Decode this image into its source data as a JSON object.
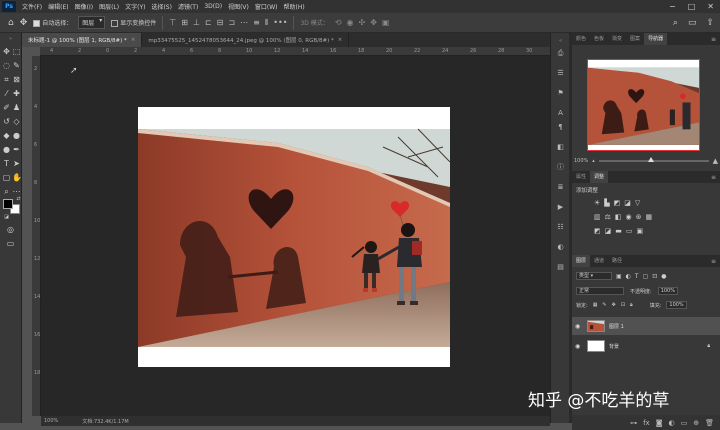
{
  "app": {
    "logo_text": "Ps"
  },
  "menu": {
    "items": [
      "文件(F)",
      "编辑(E)",
      "图像(I)",
      "图层(L)",
      "文字(Y)",
      "选择(S)",
      "滤镜(T)",
      "3D(D)",
      "视图(V)",
      "窗口(W)",
      "帮助(H)"
    ],
    "window_buttons": [
      "−",
      "□",
      "✕"
    ]
  },
  "options": {
    "auto_select_label": "自动选择：",
    "auto_select_value": "图层",
    "transform_controls_label": "显示变换控件",
    "mode_3d_label": "3D 模式："
  },
  "tabs": [
    {
      "label": "未标题-1 @ 100% (图层 1, RGB/8#) *",
      "active": true
    },
    {
      "label": "mp33475525_1452478053644_24.jpeg @ 100% (图层 0, RGB/8#) *",
      "active": false
    }
  ],
  "rulers": {
    "top": [
      "4",
      "2",
      "0",
      "2",
      "4",
      "6",
      "8",
      "10",
      "12",
      "14",
      "16",
      "18",
      "20",
      "22",
      "24",
      "26",
      "28",
      "30"
    ],
    "left": [
      "2",
      "4",
      "6",
      "8",
      "10",
      "12",
      "14",
      "16",
      "18"
    ]
  },
  "status": {
    "zoom": "100%",
    "doc_info": "文档:732.4K/1.17M"
  },
  "right_panels": {
    "top_tabs": [
      "颜色",
      "色板",
      "渐变",
      "图案",
      "导航器"
    ],
    "active_top_tab": "导航器",
    "nav_zoom": "100%",
    "adj_tabs": [
      "属性",
      "调整"
    ],
    "adj_title": "添加调整",
    "layers_tabs": [
      "图层",
      "通道",
      "路径"
    ],
    "kind_filter": "类型",
    "blend_mode": "正常",
    "opacity_label": "不透明度:",
    "opacity_value": "100%",
    "lock_label": "锁定:",
    "fill_label": "填充:",
    "fill_value": "100%",
    "layers": [
      {
        "name": "图层 1",
        "selected": true
      },
      {
        "name": "背景",
        "selected": false,
        "locked": true
      }
    ]
  },
  "watermark": "知乎 @不吃羊的草",
  "colors": {
    "wall": "#b5523a",
    "sky": "#cfd8d4",
    "ground": "#a38774",
    "heart": "#2e1512",
    "balloon": "#d82a2a"
  }
}
